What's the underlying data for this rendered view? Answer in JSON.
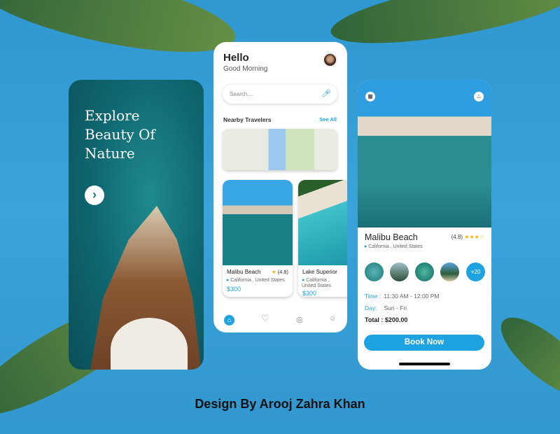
{
  "splash": {
    "title": "Explore Beauty Of Nature",
    "next_icon": "chevron-right"
  },
  "home": {
    "greeting": "Hello",
    "subgreeting": "Good Morning",
    "search": {
      "placeholder": "Search....",
      "icon": "mic-icon"
    },
    "section_title": "Nearby Travelers",
    "see_all": "See All",
    "cards": [
      {
        "title": "Malibu Beach",
        "rating": "(4.8)",
        "location": "California , United States",
        "price": "$300"
      },
      {
        "title": "Lake Superior",
        "location": "California , United States",
        "price": "$300"
      }
    ],
    "nav": [
      "home",
      "heart",
      "compass",
      "users"
    ]
  },
  "detail": {
    "title": "Malibu Beach",
    "rating": "(4.8)",
    "stars": 3,
    "location": "California , United States",
    "more_photos": "+20",
    "time_label": "Time :",
    "time_value": "11:30 AM - 12:00 PM",
    "day_label": "Day:",
    "day_value": "Sun - Fri",
    "total": "Total : $200.00",
    "book": "Book Now"
  },
  "credit": "Design By Arooj Zahra Khan",
  "colors": {
    "accent": "#1ea3e0",
    "background": "#3aa3da"
  }
}
